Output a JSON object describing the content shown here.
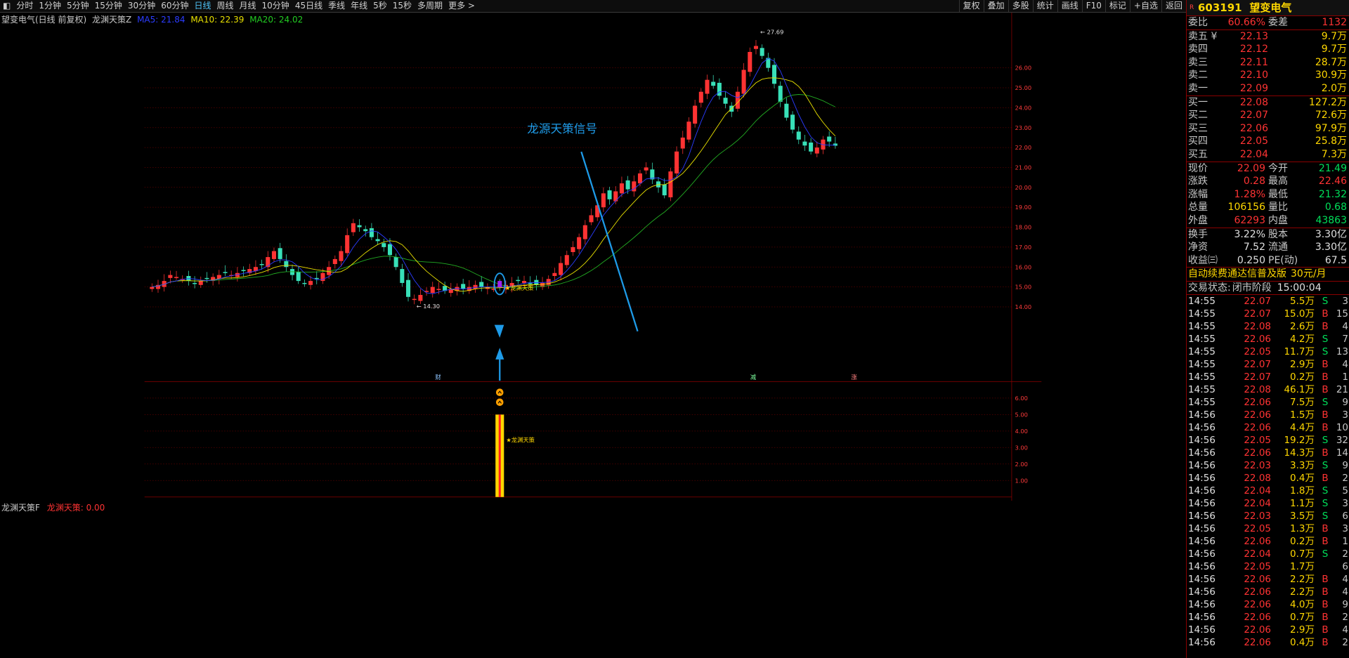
{
  "toolbar": {
    "periods": [
      "分时",
      "1分钟",
      "5分钟",
      "15分钟",
      "30分钟",
      "60分钟",
      "日线",
      "周线",
      "月线",
      "10分钟",
      "45日线",
      "季线",
      "年线",
      "5秒",
      "15秒",
      "多周期",
      "更多 >"
    ],
    "active": "日线",
    "right_buttons": [
      "复权",
      "叠加",
      "多股",
      "统计",
      "画线",
      "F10",
      "标记",
      "+自选",
      "返回"
    ]
  },
  "legend": {
    "stock": "望变电气(日线 前复权)",
    "indicator": "龙渊天策Z",
    "ma5": "MA5: 21.84",
    "ma10": "MA10: 22.39",
    "ma20": "MA20: 24.02"
  },
  "sub_legend": {
    "indicator": "龙渊天策F",
    "value": "龙渊天策: 0.00"
  },
  "annotations": {
    "signal_title": "龙源天策信号",
    "main_marker": "★龙渊天策",
    "sub_marker": "★龙渊天策",
    "high_label": "27.69",
    "low_label": "14.30",
    "event_cai": "财",
    "event_jian": "减",
    "event_zhang": "涨"
  },
  "colors": {
    "up": "#ff3333",
    "down": "#38e0b8",
    "ma5": "#2b3cff",
    "ma10": "#e8e000",
    "ma20": "#22aa22",
    "accent": "#1e9be8",
    "grid": "#5a0000"
  },
  "chart_data": {
    "type": "candlestick",
    "y_axis_ticks": [
      "26.00",
      "25.00",
      "24.00",
      "23.00",
      "22.00",
      "21.00",
      "20.00",
      "19.00",
      "18.00",
      "17.00",
      "16.00",
      "15.00",
      "14.00"
    ],
    "ylim": [
      13.7,
      27.9
    ],
    "high": 27.69,
    "low": 14.3,
    "ma_lines": [
      "MA5",
      "MA10",
      "MA20"
    ],
    "sub_y_axis_ticks": [
      "6.00",
      "5.00",
      "4.00",
      "3.00",
      "2.00",
      "1.00"
    ],
    "sub_ylim": [
      0,
      6.8
    ],
    "signal_bar_value": 5.0
  },
  "quote": {
    "code": "603191",
    "name": "望变电气",
    "r": "R",
    "webi": {
      "label": "委比",
      "value": "60.66%",
      "label2": "委差",
      "value2": "1132"
    },
    "asks": [
      {
        "label": "卖五 ¥",
        "price": "22.13",
        "vol": "9.7万"
      },
      {
        "label": "卖四",
        "price": "22.12",
        "vol": "9.7万"
      },
      {
        "label": "卖三",
        "price": "22.11",
        "vol": "28.7万"
      },
      {
        "label": "卖二",
        "price": "22.10",
        "vol": "30.9万"
      },
      {
        "label": "卖一",
        "price": "22.09",
        "vol": "2.0万"
      }
    ],
    "bids": [
      {
        "label": "买一",
        "price": "22.08",
        "vol": "127.2万"
      },
      {
        "label": "买二",
        "price": "22.07",
        "vol": "72.6万"
      },
      {
        "label": "买三",
        "price": "22.06",
        "vol": "97.9万"
      },
      {
        "label": "买四",
        "price": "22.05",
        "vol": "25.8万"
      },
      {
        "label": "买五",
        "price": "22.04",
        "vol": "7.3万"
      }
    ],
    "stats": [
      {
        "l1": "现价",
        "v1": "22.09",
        "c1": "red",
        "l2": "今开",
        "v2": "21.49",
        "c2": "green"
      },
      {
        "l1": "涨跌",
        "v1": "0.28",
        "c1": "red",
        "l2": "最高",
        "v2": "22.46",
        "c2": "red"
      },
      {
        "l1": "涨幅",
        "v1": "1.28%",
        "c1": "red",
        "l2": "最低",
        "v2": "21.32",
        "c2": "green"
      },
      {
        "l1": "总量",
        "v1": "106156",
        "c1": "yellow",
        "l2": "量比",
        "v2": "0.68",
        "c2": "green"
      },
      {
        "l1": "外盘",
        "v1": "62293",
        "c1": "red",
        "l2": "内盘",
        "v2": "43863",
        "c2": "green"
      }
    ],
    "stats2": [
      {
        "l1": "换手",
        "v1": "3.22%",
        "l2": "股本",
        "v2": "3.30亿"
      },
      {
        "l1": "净资",
        "v1": "7.52",
        "l2": "流通",
        "v2": "3.30亿"
      },
      {
        "l1": "收益㈢",
        "v1": "0.250",
        "l2": "PE(动)",
        "v2": "67.5"
      }
    ],
    "ad": {
      "text": "自动续费通达信普及版",
      "price": "30元/月"
    },
    "status": {
      "label": "交易状态:",
      "value": "闭市阶段",
      "time": "15:00:04"
    },
    "ticks": [
      {
        "t": "14:55",
        "p": "22.07",
        "v": "5.5万",
        "bs": "S",
        "n": "3"
      },
      {
        "t": "14:55",
        "p": "22.07",
        "v": "15.0万",
        "bs": "B",
        "n": "15"
      },
      {
        "t": "14:55",
        "p": "22.08",
        "v": "2.6万",
        "bs": "B",
        "n": "4"
      },
      {
        "t": "14:55",
        "p": "22.06",
        "v": "4.2万",
        "bs": "S",
        "n": "7"
      },
      {
        "t": "14:55",
        "p": "22.05",
        "v": "11.7万",
        "bs": "S",
        "n": "13"
      },
      {
        "t": "14:55",
        "p": "22.07",
        "v": "2.9万",
        "bs": "B",
        "n": "4"
      },
      {
        "t": "14:55",
        "p": "22.07",
        "v": "0.2万",
        "bs": "B",
        "n": "1"
      },
      {
        "t": "14:55",
        "p": "22.08",
        "v": "46.1万",
        "bs": "B",
        "n": "21"
      },
      {
        "t": "14:55",
        "p": "22.06",
        "v": "7.5万",
        "bs": "S",
        "n": "9"
      },
      {
        "t": "14:56",
        "p": "22.06",
        "v": "1.5万",
        "bs": "B",
        "n": "3"
      },
      {
        "t": "14:56",
        "p": "22.06",
        "v": "4.4万",
        "bs": "B",
        "n": "10"
      },
      {
        "t": "14:56",
        "p": "22.05",
        "v": "19.2万",
        "bs": "S",
        "n": "32"
      },
      {
        "t": "14:56",
        "p": "22.06",
        "v": "14.3万",
        "bs": "B",
        "n": "14"
      },
      {
        "t": "14:56",
        "p": "22.03",
        "v": "3.3万",
        "bs": "S",
        "n": "9"
      },
      {
        "t": "14:56",
        "p": "22.08",
        "v": "0.4万",
        "bs": "B",
        "n": "2"
      },
      {
        "t": "14:56",
        "p": "22.04",
        "v": "1.8万",
        "bs": "S",
        "n": "5"
      },
      {
        "t": "14:56",
        "p": "22.04",
        "v": "1.1万",
        "bs": "S",
        "n": "3"
      },
      {
        "t": "14:56",
        "p": "22.03",
        "v": "3.5万",
        "bs": "S",
        "n": "6"
      },
      {
        "t": "14:56",
        "p": "22.05",
        "v": "1.3万",
        "bs": "B",
        "n": "3"
      },
      {
        "t": "14:56",
        "p": "22.06",
        "v": "0.2万",
        "bs": "B",
        "n": "1"
      },
      {
        "t": "14:56",
        "p": "22.04",
        "v": "0.7万",
        "bs": "S",
        "n": "2"
      },
      {
        "t": "14:56",
        "p": "22.05",
        "v": "1.7万",
        "bs": "",
        "n": "6"
      },
      {
        "t": "14:56",
        "p": "22.06",
        "v": "2.2万",
        "bs": "B",
        "n": "4"
      },
      {
        "t": "14:56",
        "p": "22.06",
        "v": "2.2万",
        "bs": "B",
        "n": "4"
      },
      {
        "t": "14:56",
        "p": "22.06",
        "v": "4.0万",
        "bs": "B",
        "n": "9"
      },
      {
        "t": "14:56",
        "p": "22.06",
        "v": "0.7万",
        "bs": "B",
        "n": "2"
      },
      {
        "t": "14:56",
        "p": "22.06",
        "v": "2.9万",
        "bs": "B",
        "n": "4"
      },
      {
        "t": "14:56",
        "p": "22.06",
        "v": "0.4万",
        "bs": "B",
        "n": "2"
      }
    ]
  }
}
